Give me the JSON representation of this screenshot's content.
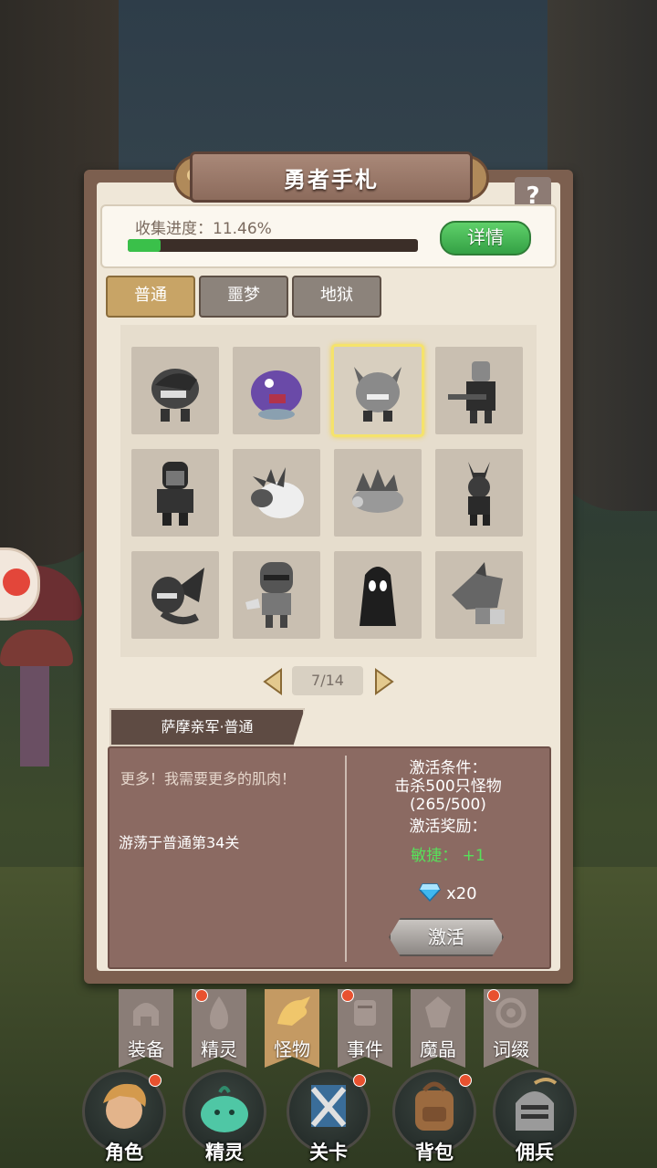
{
  "panel": {
    "title": "勇者手札",
    "help_label": "?"
  },
  "progress": {
    "label": "收集进度：11.46%",
    "fraction": 0.1146,
    "detail_button": "详情"
  },
  "tabs": [
    {
      "label": "普通",
      "active": true
    },
    {
      "label": "噩梦",
      "active": false
    },
    {
      "label": "地狱",
      "active": false
    }
  ],
  "monsters": [
    {
      "icon": "shark-monster-icon",
      "selected": false
    },
    {
      "icon": "purple-ogre-icon",
      "selected": false
    },
    {
      "icon": "horned-brute-icon",
      "selected": true
    },
    {
      "icon": "masked-gunner-icon",
      "selected": false
    },
    {
      "icon": "hooded-thug-icon",
      "selected": false
    },
    {
      "icon": "spiked-sheep-icon",
      "selected": false
    },
    {
      "icon": "spiky-lizard-icon",
      "selected": false
    },
    {
      "icon": "jackal-warrior-icon",
      "selected": false
    },
    {
      "icon": "winged-dragon-icon",
      "selected": false
    },
    {
      "icon": "helmet-knight-icon",
      "selected": false
    },
    {
      "icon": "shadow-reaper-icon",
      "selected": false
    },
    {
      "icon": "armored-beast-icon",
      "selected": false
    }
  ],
  "pager": {
    "text": "7/14"
  },
  "monster_info": {
    "name": "萨摩亲军·普通",
    "quote": "更多！我需要更多的肌肉！",
    "location": "游荡于普通第34关",
    "condition_title": "激活条件：",
    "condition_text": "击杀500只怪物",
    "condition_progress": "(265/500)",
    "reward_title": "激活奖励：",
    "reward_stat": "敏捷：  +1",
    "reward_gem": "x20",
    "activate_button": "激活"
  },
  "sub_tabs": [
    {
      "label": "装备",
      "icon": "helmet-icon",
      "active": false,
      "dot": false
    },
    {
      "label": "精灵",
      "icon": "flame-spirit-icon",
      "active": false,
      "dot": true
    },
    {
      "label": "怪物",
      "icon": "dragon-icon",
      "active": true,
      "dot": false
    },
    {
      "label": "事件",
      "icon": "scroll-icon",
      "active": false,
      "dot": true
    },
    {
      "label": "魔晶",
      "icon": "crystal-icon",
      "active": false,
      "dot": false
    },
    {
      "label": "词缀",
      "icon": "spiral-icon",
      "active": false,
      "dot": true
    }
  ],
  "bottom_nav": [
    {
      "label": "角色",
      "icon": "hero-portrait-icon",
      "dot": true
    },
    {
      "label": "精灵",
      "icon": "slime-icon",
      "dot": false
    },
    {
      "label": "关卡",
      "icon": "crossed-swords-icon",
      "dot": true
    },
    {
      "label": "背包",
      "icon": "backpack-icon",
      "dot": true
    },
    {
      "label": "佣兵",
      "icon": "knight-helm-icon",
      "dot": false
    }
  ],
  "colors": {
    "accent_gold": "#c8a466",
    "progress_green": "#3ac04a",
    "bonus_green": "#57e05a",
    "selection": "#f5e36b",
    "notify_red": "#e8512f"
  }
}
